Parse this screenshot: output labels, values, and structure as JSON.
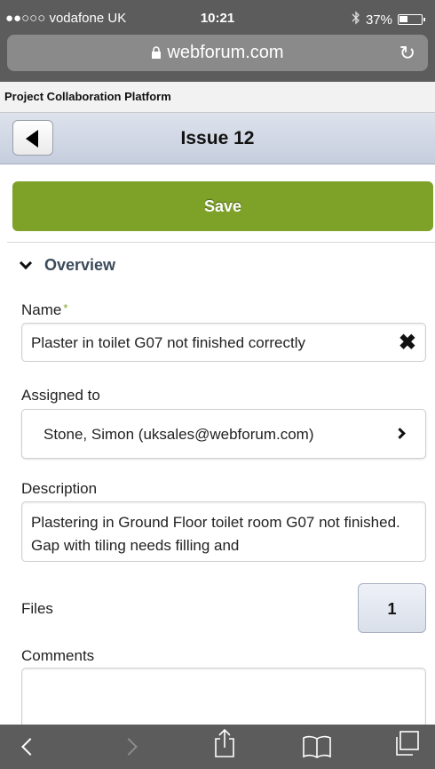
{
  "status_bar": {
    "carrier": "●●○○○ vodafone UK",
    "time": "10:21",
    "battery": "37%",
    "battery_level": 0.37,
    "url": "webforum.com"
  },
  "app": {
    "platform_title": "Project Collaboration Platform",
    "page_title": "Issue 12",
    "save_label": "Save"
  },
  "overview": {
    "section_title": "Overview",
    "name_label": "Name",
    "required_mark": "*",
    "name_value": "Plaster in toilet G07 not finished correctly",
    "assigned_label": "Assigned to",
    "assigned_value": "Stone, Simon (uksales@webforum.com)",
    "description_label": "Description",
    "description_value": "Plastering in Ground Floor toilet room G07 not finished. Gap with tiling needs filling and",
    "files_label": "Files",
    "files_count": "1",
    "comments_label": "Comments",
    "comments_value": ""
  },
  "icons": {
    "back": "back-arrow-icon",
    "clear": "clear-x-icon",
    "chevron_right": "chevron-right-icon",
    "chevron_down": "chevron-down-icon"
  },
  "colors": {
    "accent_green": "#7ea128",
    "browser_chrome": "#5c5c5c",
    "header_blue": "#c6cede"
  }
}
